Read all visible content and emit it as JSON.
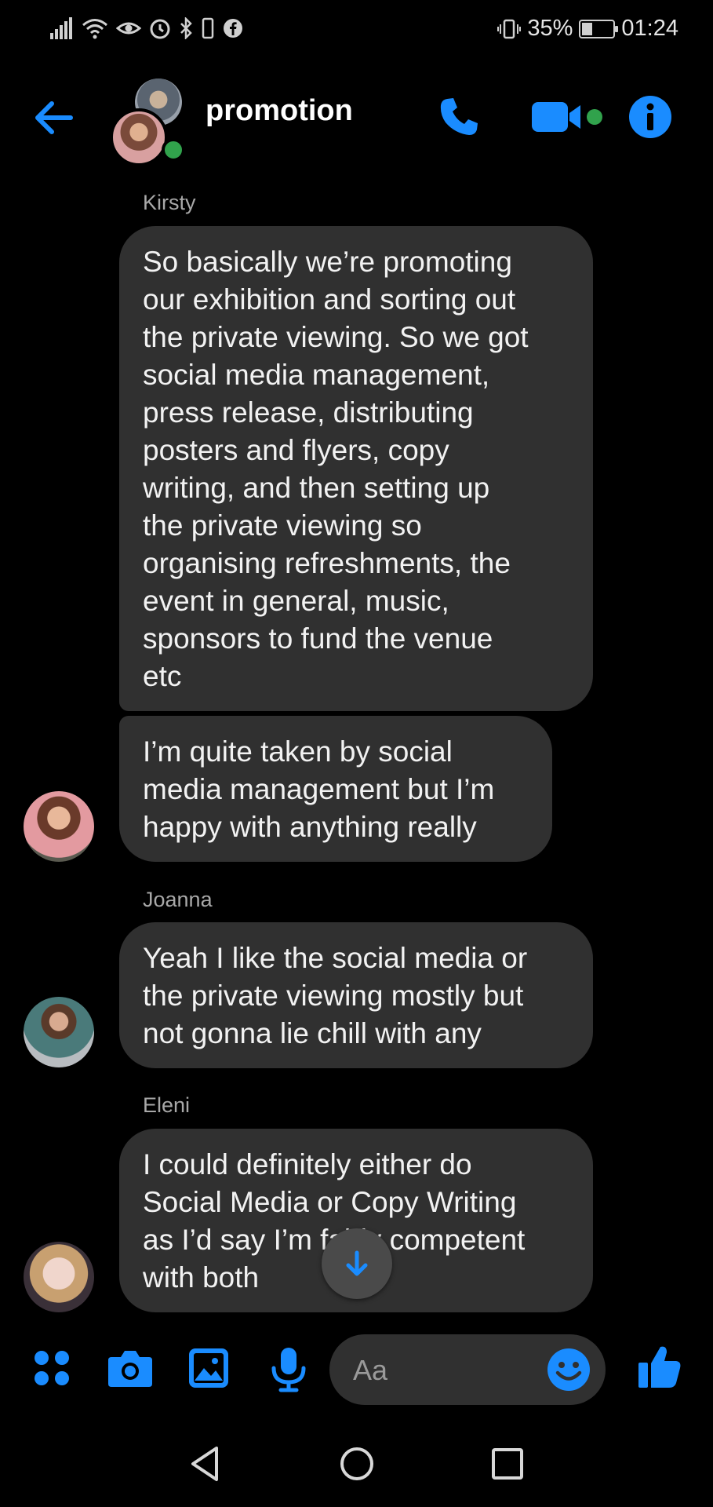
{
  "status_bar": {
    "battery_percent": "35%",
    "battery_level": 0.35,
    "time": "01:24",
    "icons": [
      "signal-icon",
      "wifi-icon",
      "eye-icon",
      "alarm-icon",
      "bluetooth-icon",
      "facebook-icon",
      "vibrate-icon"
    ]
  },
  "header": {
    "title": "promotion",
    "icons": [
      "back-arrow-icon",
      "phone-icon",
      "video-camera-icon",
      "info-icon"
    ],
    "accent": "#1a8cff",
    "online_color": "#31a24c"
  },
  "messages": [
    {
      "sender": "Kirsty",
      "lines": [
        "So basically we’re promoting",
        "our exhibition and sorting out",
        "the private viewing. So we got",
        "social media management,",
        "press release, distributing",
        "posters and flyers, copy",
        "writing, and then setting up",
        "the private viewing so",
        "organising refreshments, the",
        "event in general, music,",
        "sponsors to fund the venue",
        "etc"
      ]
    },
    {
      "sender": "",
      "lines": [
        "I’m quite taken by social",
        "media management but I’m",
        "happy with anything really"
      ]
    },
    {
      "sender": "Joanna",
      "lines": [
        "Yeah I like the social media or",
        "the private viewing mostly but",
        "not gonna lie chill with any"
      ]
    },
    {
      "sender": "Eleni",
      "lines": [
        "I could definitely either do",
        "Social Media or Copy Writing",
        "as I’d say I’m fairly competent",
        "with both"
      ]
    }
  ],
  "composer": {
    "placeholder": "Aa",
    "icons": [
      "apps-grid-icon",
      "camera-icon",
      "gallery-icon",
      "microphone-icon",
      "emoji-icon",
      "thumbs-up-icon"
    ]
  },
  "nav_bar": {
    "icons": [
      "back-triangle-icon",
      "home-circle-icon",
      "recents-square-icon"
    ]
  },
  "colors": {
    "background": "#000000",
    "bubble": "#303030",
    "sender_name": "#a8a8a8"
  }
}
